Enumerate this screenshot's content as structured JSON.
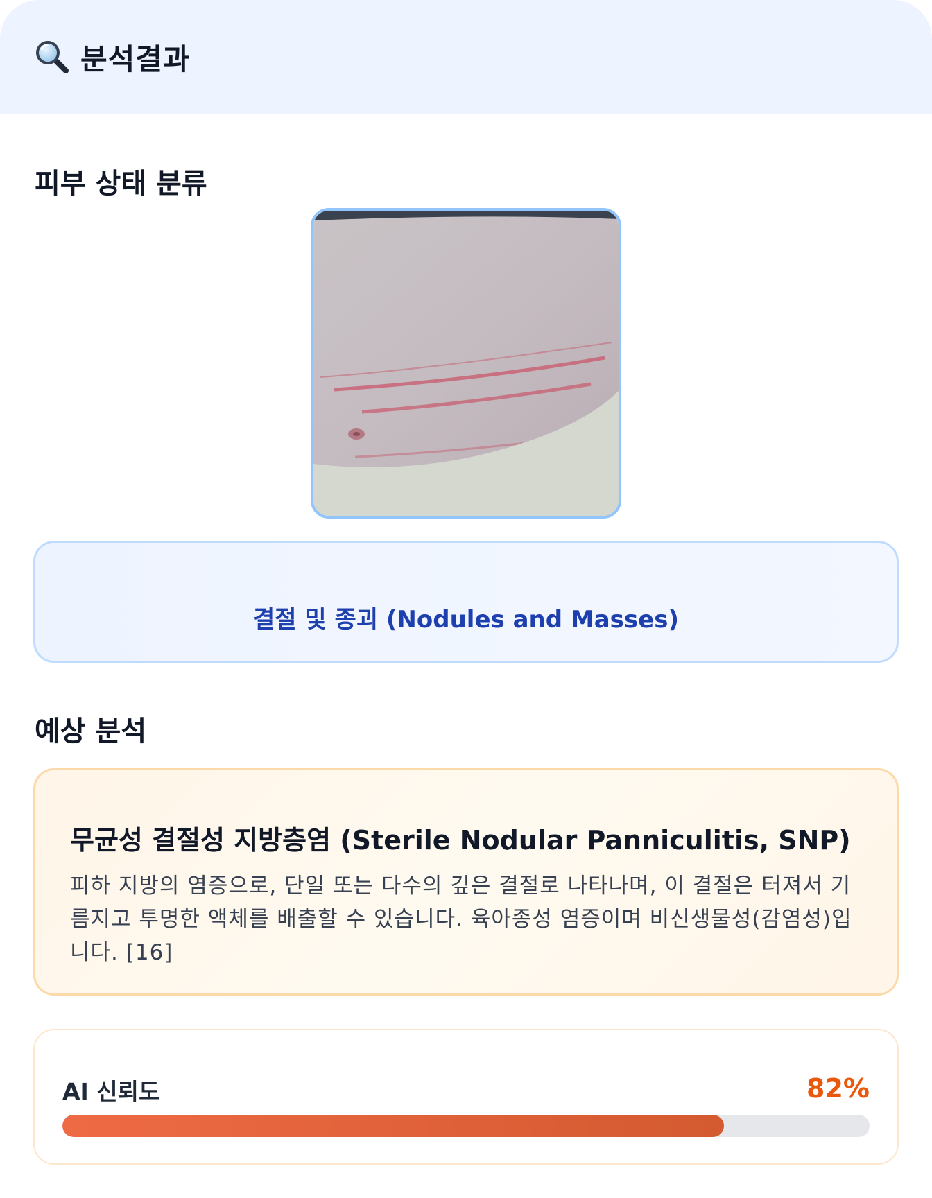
{
  "header": {
    "icon": "magnifier-icon",
    "title": "분석결과"
  },
  "classification": {
    "section_title": "피부 상태 분류",
    "label": "결절 및 종괴 (Nodules and Masses)"
  },
  "prediction": {
    "section_title": "예상 분석",
    "name": "무균성 결절성 지방층염 (Sterile Nodular Panniculitis, SNP)",
    "description": "피하 지방의 염증으로, 단일 또는 다수의 깊은 결절로 나타나며, 이 결절은 터져서 기름지고 투명한 액체를 배출할 수 있습니다. 육아종성 염증이며 비신생물성(감염성)입니다. [16]"
  },
  "confidence": {
    "label": "AI 신뢰도",
    "value_text": "82%",
    "value": 0.82
  },
  "colors": {
    "header_bg": "#eef4ff",
    "accent_blue": "#1e40af",
    "accent_orange": "#ea580c"
  }
}
